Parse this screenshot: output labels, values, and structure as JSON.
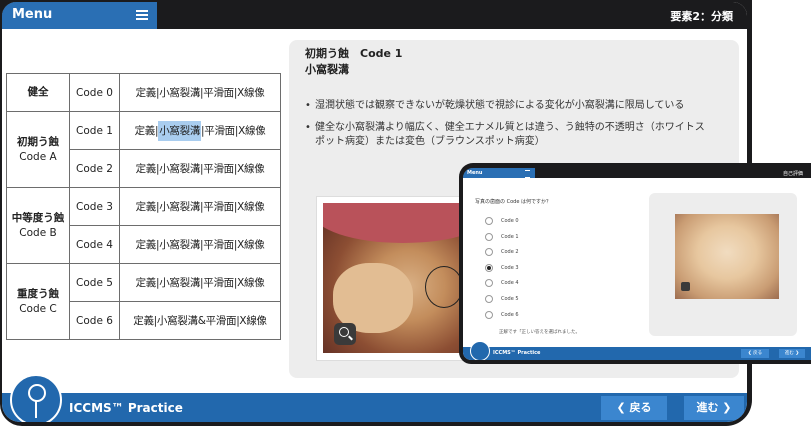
{
  "header": {
    "menu_label": "Menu",
    "section": "要素2：分類"
  },
  "table": {
    "rows": [
      {
        "cat_name": "健全",
        "cat_sub": "",
        "codes": [
          {
            "code": "Code 0",
            "methods_pre": "定義|小窩裂溝|平滑面|X線像",
            "methods_hl": "",
            "methods_post": ""
          }
        ]
      },
      {
        "cat_name": "初期う蝕",
        "cat_sub": "Code A",
        "codes": [
          {
            "code": "Code 1",
            "methods_pre": "定義|",
            "methods_hl": "小窩裂溝",
            "methods_post": "|平滑面|X線像"
          },
          {
            "code": "Code 2",
            "methods_pre": "定義|小窩裂溝|平滑面|X線像",
            "methods_hl": "",
            "methods_post": ""
          }
        ]
      },
      {
        "cat_name": "中等度う蝕",
        "cat_sub": "Code B",
        "codes": [
          {
            "code": "Code 3",
            "methods_pre": "定義|小窩裂溝|平滑面|X線像",
            "methods_hl": "",
            "methods_post": ""
          },
          {
            "code": "Code 4",
            "methods_pre": "定義|小窩裂溝|平滑面|X線像",
            "methods_hl": "",
            "methods_post": ""
          }
        ]
      },
      {
        "cat_name": "重度う蝕",
        "cat_sub": "Code C",
        "codes": [
          {
            "code": "Code 5",
            "methods_pre": "定義|小窩裂溝|平滑面|X線像",
            "methods_hl": "",
            "methods_post": ""
          },
          {
            "code": "Code 6",
            "methods_pre": "定義|小窩裂溝&平滑面|X線像",
            "methods_hl": "",
            "methods_post": ""
          }
        ]
      }
    ]
  },
  "panel": {
    "title_line1": "初期う蝕　Code 1",
    "title_line2": "小窩裂溝",
    "bullets": [
      "湿潤状態では観察できないが乾燥状態で視診による変化が小窩裂溝に限局している",
      "健全な小窩裂溝より幅広く、健全エナメル質とは違う、う蝕特の不透明さ（ホワイトスポット病変）または変色（ブラウンスポット病変）"
    ]
  },
  "footer": {
    "app_name": "ICCMS™ Practice",
    "back_label": "❮ 戻る",
    "next_label": "進む ❯"
  },
  "mini": {
    "menu_label": "Menu",
    "section": "自己評価",
    "question": "写真の歯面の Code は何ですか？",
    "options": [
      "Code 0",
      "Code 1",
      "Code 2",
      "Code 3",
      "Code 4",
      "Code 5",
      "Code 6"
    ],
    "selected_index": 3,
    "feedback": "正解です「正しい答えを選ばれました。",
    "app_name": "ICCMS™ Practice",
    "back_label": "❮ 戻る",
    "next_label": "進む ❯"
  },
  "colors": {
    "accent_blue": "#2268ad",
    "highlight": "#a9cdef",
    "frame": "#1b1b1d"
  }
}
